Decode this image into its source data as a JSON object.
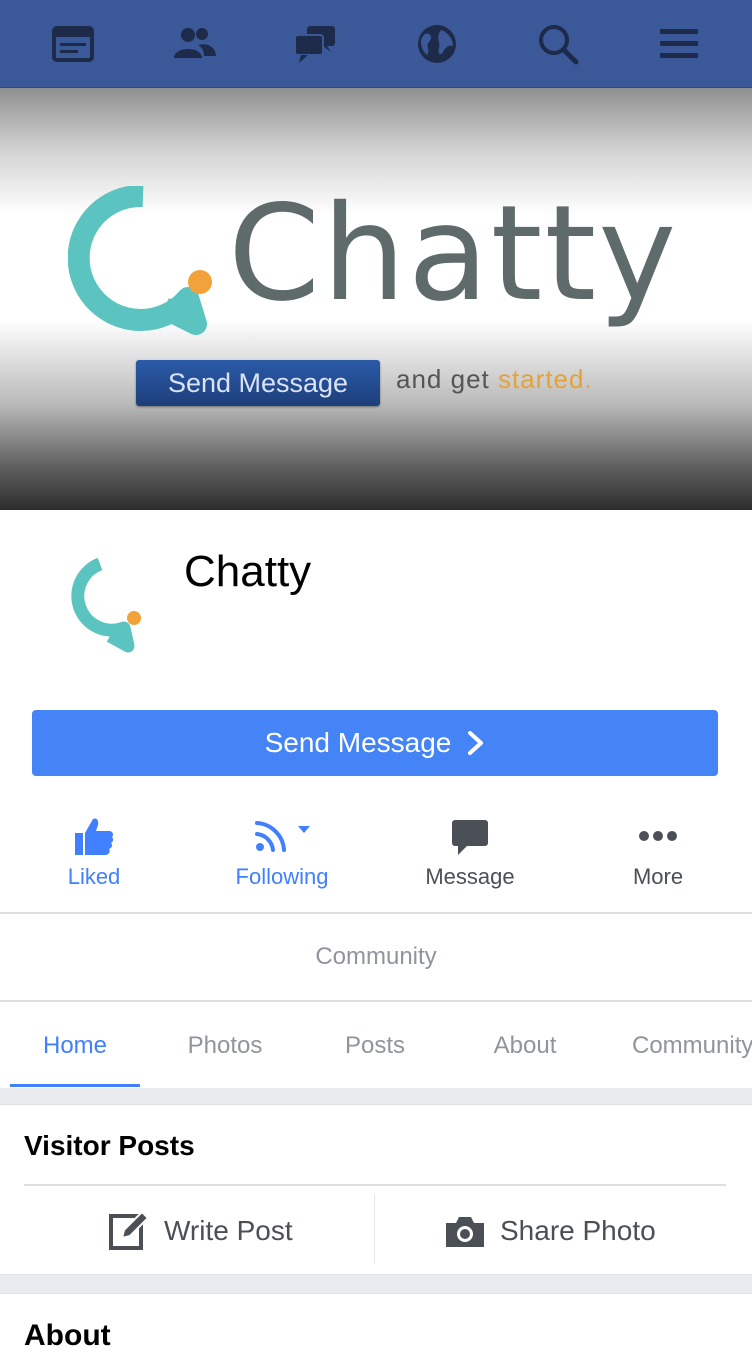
{
  "topbar": {
    "icons": [
      "news-feed-icon",
      "friends-icon",
      "messages-icon",
      "globe-icon",
      "search-icon",
      "menu-icon"
    ]
  },
  "cover": {
    "brand_name": "Chatty",
    "button_label": "Send Message",
    "tagline_prefix": "and get",
    "tagline_accent": "started."
  },
  "page": {
    "title": "Chatty"
  },
  "send_message": {
    "label": "Send Message"
  },
  "actions": [
    {
      "label": "Liked"
    },
    {
      "label": "Following"
    },
    {
      "label": "Message"
    },
    {
      "label": "More"
    }
  ],
  "community_label": "Community",
  "tabs": [
    {
      "label": "Home"
    },
    {
      "label": "Photos"
    },
    {
      "label": "Posts"
    },
    {
      "label": "About"
    },
    {
      "label": "Community"
    }
  ],
  "visitor_posts": {
    "title": "Visitor Posts",
    "write_post": "Write Post",
    "share_photo": "Share Photo"
  },
  "about": {
    "title": "About"
  },
  "colors": {
    "facebook_blue": "#3b5998",
    "accent_blue": "#4080ff",
    "button_blue": "#4584f6",
    "brand_teal": "#5bc3c0",
    "brand_orange": "#f2a23a"
  }
}
